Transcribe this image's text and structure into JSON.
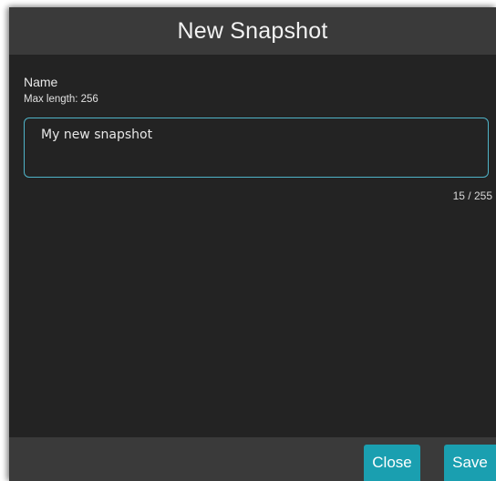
{
  "dialog": {
    "title": "New Snapshot"
  },
  "name_field": {
    "label": "Name",
    "hint": "Max length: 256",
    "value": "My new snapshot",
    "char_count": "15 / 255"
  },
  "footer": {
    "close_label": "Close",
    "save_label": "Save"
  },
  "colors": {
    "accent": "#1a9fb0",
    "input_border": "#4fb3c8",
    "dialog_bg": "#232323",
    "bar_bg": "#3a3a3a"
  }
}
